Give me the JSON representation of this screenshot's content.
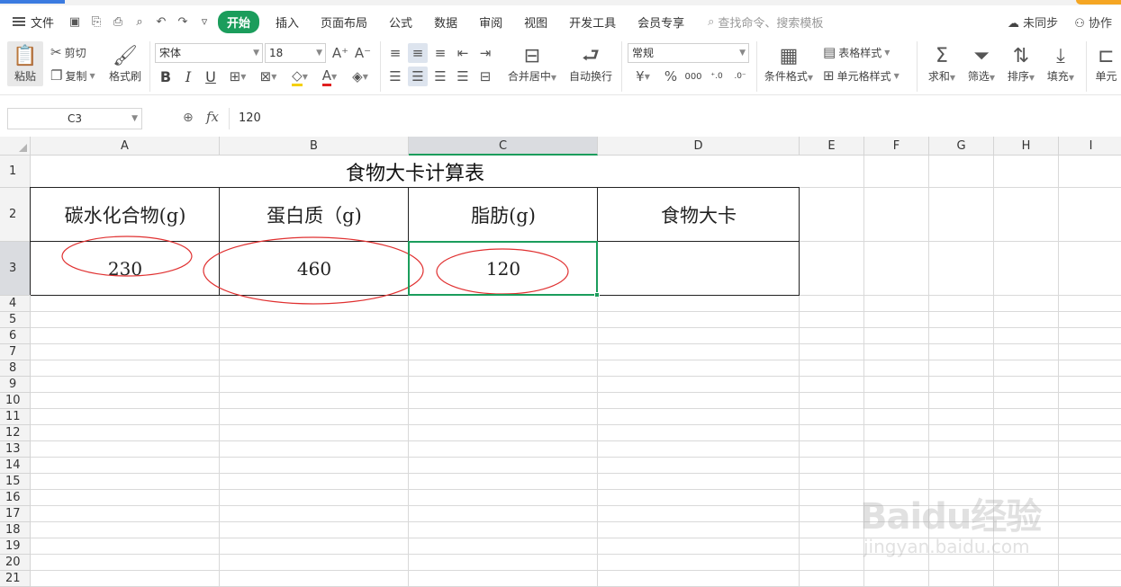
{
  "menubar": {
    "file_label": "文件",
    "tabs": [
      "开始",
      "插入",
      "页面布局",
      "公式",
      "数据",
      "审阅",
      "视图",
      "开发工具",
      "会员专享"
    ],
    "search_placeholder": "查找命令、搜索模板",
    "sync_label": "未同步",
    "collab_label": "协作"
  },
  "ribbon": {
    "paste": "粘贴",
    "cut": "剪切",
    "copy": "复制",
    "format_painter": "格式刷",
    "font_name": "宋体",
    "font_size": "18",
    "merge_center": "合并居中",
    "wrap_text": "自动换行",
    "number_format": "常规",
    "conditional_format": "条件格式",
    "table_style": "表格样式",
    "cell_style": "单元格样式",
    "sum": "求和",
    "filter": "筛选",
    "sort": "排序",
    "fill": "填充",
    "cell": "单元"
  },
  "formula_bar": {
    "name_box": "C3",
    "fx": "fx",
    "value": "120"
  },
  "grid": {
    "columns": [
      "A",
      "B",
      "C",
      "D",
      "E",
      "F",
      "G",
      "H",
      "I"
    ],
    "rows": [
      "1",
      "2",
      "3",
      "4",
      "5",
      "6",
      "7",
      "8",
      "9",
      "10",
      "11",
      "12",
      "13",
      "14",
      "15",
      "16",
      "17",
      "18",
      "19",
      "20",
      "21"
    ],
    "selected_cell": "C3"
  },
  "table": {
    "title": "食物大卡计算表",
    "headers": [
      "碳水化合物(g)",
      "蛋白质（g)",
      "脂肪(g)",
      "食物大卡"
    ],
    "values": [
      "230",
      "460",
      "120",
      ""
    ]
  },
  "watermark": {
    "brand": "Baidu经验",
    "url": "jingyan.baidu.com"
  },
  "colors": {
    "accent": "#1b9d5c",
    "annotation": "#e03030"
  }
}
